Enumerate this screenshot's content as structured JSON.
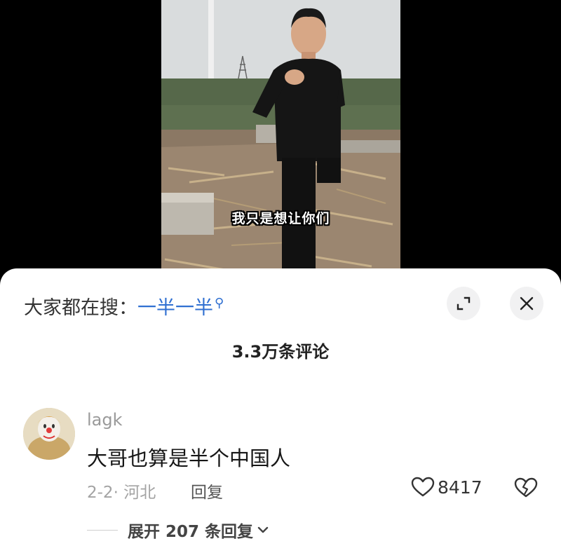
{
  "video": {
    "subtitle": "我只是想让你们"
  },
  "sheet": {
    "search_prefix": "大家都在搜：",
    "search_keyword": "一半一半",
    "comment_count": "3.3万条评论",
    "icons": {
      "search": "search-icon",
      "expand": "expand-icon",
      "close": "close-icon"
    }
  },
  "comment": {
    "username": "lagk",
    "text": "大哥也算是半个中国人",
    "meta": "2-2· 河北",
    "reply_label": "回复",
    "like_count": "8417",
    "expand_replies": "展开 207 条回复"
  },
  "colors": {
    "keyword": "#2f6fd1",
    "sheet_bg": "#ffffff",
    "page_bg": "#000000"
  }
}
